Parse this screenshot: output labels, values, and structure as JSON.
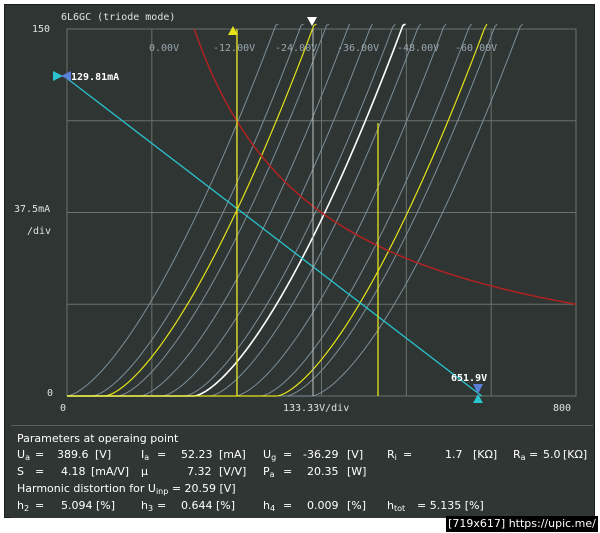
{
  "plot": {
    "title": "6L6GC (triode mode)",
    "y_top": "150",
    "y_mid": "37.5mA",
    "y_div": "/div",
    "y_zero": "0",
    "x_zero": "0",
    "x_mid": "133.33V/div",
    "x_max": "800",
    "grid_labels": [
      "0.00V",
      "-12.00V",
      "-24.00V",
      "-36.00V",
      "-48.00V",
      "-60.00V"
    ],
    "load_line_current": "129.81mA",
    "load_line_voltage": "651.9V",
    "colors": {
      "background": "#2e3532",
      "grid": "#6a726d",
      "curve": "#7d8f9a",
      "highlight_curve": "#e5e219",
      "operating_curve": "#ffffff",
      "load_line": "#29c4cf",
      "max_power": "#b22222"
    }
  },
  "chart_data": {
    "type": "line",
    "title": "6L6GC (triode mode)",
    "xlim": [
      0,
      800
    ],
    "ylim": [
      0,
      150
    ],
    "x_unit": "V",
    "y_unit": "mA",
    "grid_bias_labels": [
      "0.00V",
      "-12.00V",
      "-24.00V",
      "-36.00V",
      "-48.00V",
      "-60.00V"
    ],
    "load_line": {
      "x": [
        0,
        651.9
      ],
      "y": [
        129.81,
        0
      ]
    },
    "operating_point": {
      "x": 389.6,
      "y": 52.23,
      "grid": -36.29
    }
  },
  "params": {
    "heading": "Parameters at operaing point",
    "ua_label": "U",
    "ua_sub": "a",
    "ua_value": "389.6",
    "ua_unit": "[V]",
    "ia_label": "I",
    "ia_sub": "a",
    "ia_value": "52.23",
    "ia_unit": "[mA]",
    "ug_label": "U",
    "ug_sub": "g",
    "ug_value": "-36.29",
    "ug_unit": "[V]",
    "ri_label": "R",
    "ri_sub": "i",
    "ri_value": "1.7",
    "ri_unit": "[KΩ]",
    "ra_label": "R",
    "ra_sub": "a",
    "ra_value": "5.0",
    "ra_unit": "[KΩ]",
    "s_label": "S",
    "s_value": "4.18",
    "s_unit": "[mA/V]",
    "mu_label": "μ",
    "mu_value": "7.32",
    "mu_unit": "[V/V]",
    "pa_label": "P",
    "pa_sub": "a",
    "pa_value": "20.35",
    "pa_unit": "[W]",
    "dist_text": "Harmonic distortion for U",
    "dist_sub": "inp",
    "dist_value": "= 20.59 [V]",
    "h2_label": "h",
    "h2_sub": "2",
    "h2_value": "5.094 [%]",
    "h3_label": "h",
    "h3_sub": "3",
    "h3_value": "0.644 [%]",
    "h4_label": "h",
    "h4_sub": "4",
    "h4_value": "0.009",
    "h4_unit": "[%]",
    "htot_label": "h",
    "htot_sub": "tot",
    "htot_value": "= 5.135 [%]",
    "eq": "="
  },
  "caption": "[719x617] https://upic.me/"
}
